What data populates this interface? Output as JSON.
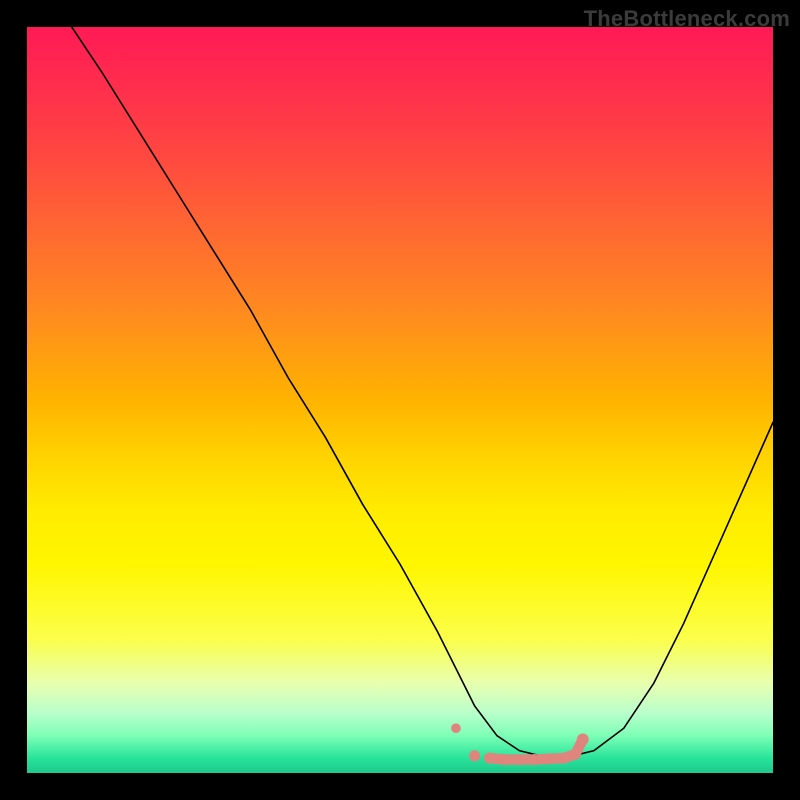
{
  "watermark": "TheBottleneck.com",
  "chart_data": {
    "type": "line",
    "title": "",
    "xlabel": "",
    "ylabel": "",
    "xlim": [
      0,
      100
    ],
    "ylim": [
      0,
      100
    ],
    "background_gradient": {
      "top_color": "#ff1a55",
      "mid_color": "#ffec00",
      "bottom_color": "#1fc98e",
      "meaning": "red=high bottleneck, green=low bottleneck"
    },
    "series": [
      {
        "name": "bottleneck-curve",
        "color": "#000000",
        "x": [
          6,
          10,
          15,
          20,
          25,
          30,
          35,
          40,
          45,
          50,
          55,
          58,
          60,
          63,
          66,
          70,
          72,
          76,
          80,
          84,
          88,
          92,
          96,
          100
        ],
        "values": [
          100,
          94,
          86,
          78,
          70,
          62,
          53,
          45,
          36,
          28,
          19,
          13,
          9,
          5,
          3,
          2,
          2,
          3,
          6,
          12,
          20,
          29,
          38,
          47
        ]
      },
      {
        "name": "optimal-range-markers",
        "color": "#e0857d",
        "type": "scatter",
        "x": [
          57.5,
          60,
          62,
          64,
          66,
          68,
          70,
          72,
          73.5,
          74.5
        ],
        "values": [
          6.0,
          2.3,
          2.0,
          1.8,
          1.8,
          1.8,
          1.9,
          2.0,
          2.5,
          4.5
        ]
      }
    ]
  }
}
